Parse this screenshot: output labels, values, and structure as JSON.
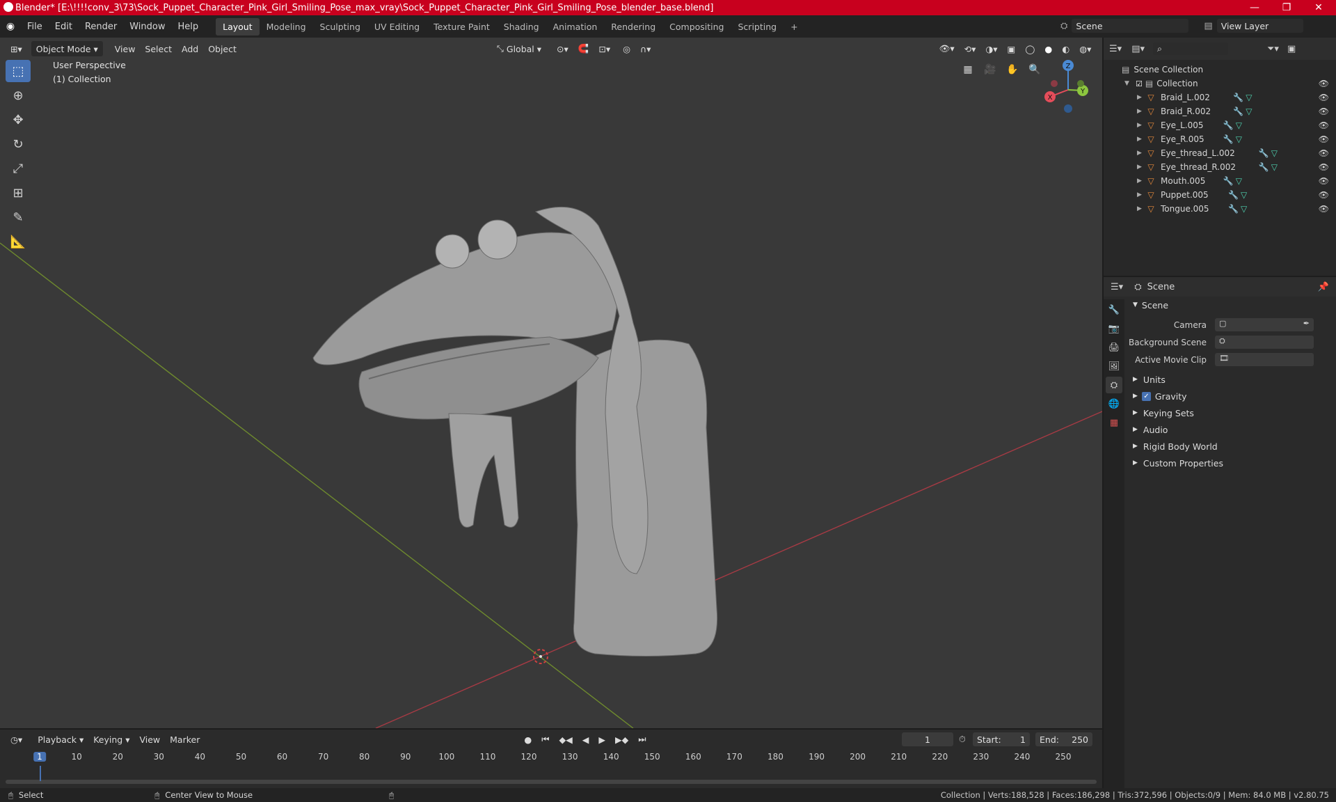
{
  "window": {
    "title": "Blender* [E:\\!!!!conv_3\\73\\Sock_Puppet_Character_Pink_Girl_Smiling_Pose_max_vray\\Sock_Puppet_Character_Pink_Girl_Smiling_Pose_blender_base.blend]",
    "minimize": "—",
    "maximize": "❐",
    "close": "✕"
  },
  "menu": {
    "items": [
      "File",
      "Edit",
      "Render",
      "Window",
      "Help"
    ],
    "workspaces": [
      "Layout",
      "Modeling",
      "Sculpting",
      "UV Editing",
      "Texture Paint",
      "Shading",
      "Animation",
      "Rendering",
      "Compositing",
      "Scripting"
    ],
    "active_workspace": "Layout",
    "add_workspace": "+",
    "scene_name": "Scene",
    "view_layer": "View Layer"
  },
  "viewport": {
    "mode": "Object Mode",
    "menus": [
      "View",
      "Select",
      "Add",
      "Object"
    ],
    "transform_orientation": "Global",
    "perspective": "User Perspective",
    "collection": "(1) Collection",
    "gizmo": {
      "x": "X",
      "y": "Y",
      "z": "Z"
    }
  },
  "outliner": {
    "root": "Scene Collection",
    "collection": "Collection",
    "objects": [
      "Braid_L.002",
      "Braid_R.002",
      "Eye_L.005",
      "Eye_R.005",
      "Eye_thread_L.002",
      "Eye_thread_R.002",
      "Mouth.005",
      "Puppet.005",
      "Tongue.005"
    ]
  },
  "properties": {
    "context": "Scene",
    "panel_title": "Scene",
    "fields": [
      {
        "label": "Camera"
      },
      {
        "label": "Background Scene"
      },
      {
        "label": "Active Movie Clip"
      }
    ],
    "subpanels": [
      "Units",
      "Gravity",
      "Keying Sets",
      "Audio",
      "Rigid Body World",
      "Custom Properties"
    ],
    "gravity_checked": true
  },
  "timeline": {
    "menus": [
      "Playback",
      "Keying",
      "View",
      "Marker"
    ],
    "current_frame": "1",
    "start_label": "Start:",
    "start": "1",
    "end_label": "End:",
    "end": "250",
    "ruler_labels": [
      "1",
      "10",
      "20",
      "30",
      "40",
      "50",
      "60",
      "70",
      "80",
      "90",
      "100",
      "110",
      "120",
      "130",
      "140",
      "150",
      "160",
      "170",
      "180",
      "190",
      "200",
      "210",
      "220",
      "230",
      "240",
      "250"
    ]
  },
  "status": {
    "select": "Select",
    "center_view": "Center View to Mouse",
    "stats": "Collection | Verts:188,528 | Faces:186,298 | Tris:372,596 | Objects:0/9 | Mem: 84.0 MB | v2.80.75"
  },
  "colors": {
    "title_bar": "#c8001e",
    "accent": "#4772b3",
    "x_axis": "#e44d5a",
    "y_axis": "#8cc63f",
    "z_axis": "#4a8ad4",
    "object_icon": "#e6893b"
  }
}
